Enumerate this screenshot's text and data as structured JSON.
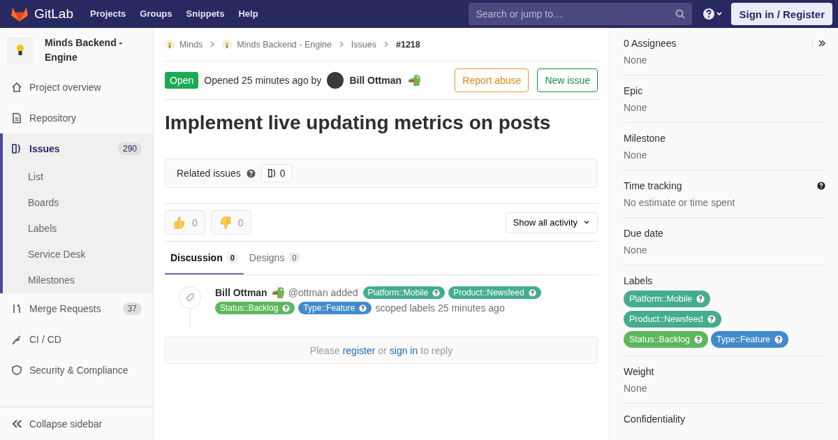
{
  "header": {
    "brand": "GitLab",
    "nav": [
      "Projects",
      "Groups",
      "Snippets",
      "Help"
    ],
    "search": {
      "placeholder": "Search or jump to…"
    },
    "sign_in": "Sign in / Register"
  },
  "sidebar": {
    "project": "Minds Backend - Engine",
    "items": [
      {
        "label": "Project overview",
        "selected": false
      },
      {
        "label": "Repository",
        "selected": false
      },
      {
        "label": "Issues",
        "count": "290",
        "selected": true,
        "children": [
          {
            "label": "List"
          },
          {
            "label": "Boards"
          },
          {
            "label": "Labels"
          },
          {
            "label": "Service Desk"
          },
          {
            "label": "Milestones"
          }
        ]
      },
      {
        "label": "Merge Requests",
        "count": "37",
        "selected": false
      },
      {
        "label": "CI / CD",
        "selected": false
      },
      {
        "label": "Security & Compliance",
        "selected": false
      }
    ],
    "collapse": "Collapse sidebar"
  },
  "breadcrumb": [
    "Minds",
    "Minds Backend - Engine",
    "Issues",
    "#1218"
  ],
  "issue": {
    "status": "Open",
    "opened": "Opened 25 minutes ago by",
    "author": "Bill Ottman",
    "report": "Report abuse",
    "new_issue": "New issue",
    "title": "Implement live updating metrics on posts"
  },
  "related": {
    "label": "Related issues",
    "count": "0"
  },
  "awards": [
    {
      "kind": "thumbsup",
      "count": "0"
    },
    {
      "kind": "thumbsdown",
      "count": "0"
    }
  ],
  "activity_filter": "Show all activity",
  "tabs": [
    {
      "label": "Discussion",
      "count": "0",
      "selected": true
    },
    {
      "label": "Designs",
      "count": "0",
      "selected": false
    }
  ],
  "note": {
    "author": "Bill Ottman",
    "handle": "@ottman added",
    "suffix": "scoped labels 25 minutes ago",
    "labels": [
      {
        "text": "Platform::Mobile",
        "color": "#44ad8e"
      },
      {
        "text": "Product::Newsfeed",
        "color": "#44ad8e"
      },
      {
        "text": "Status::Backlog",
        "color": "#5cb85c"
      },
      {
        "text": "Type::Feature",
        "color": "#428bca"
      }
    ]
  },
  "reply": {
    "before": "Please",
    "register": "register",
    "middle": "or",
    "sign_in": "sign in",
    "after": "to reply"
  },
  "right_sidebar": [
    {
      "kind": "text",
      "title": "0 Assignees",
      "value": "None"
    },
    {
      "kind": "text",
      "title": "Epic",
      "value": "None"
    },
    {
      "kind": "text",
      "title": "Milestone",
      "value": "None"
    },
    {
      "kind": "text",
      "title": "Time tracking",
      "value": "No estimate or time spent",
      "help": true
    },
    {
      "kind": "text",
      "title": "Due date",
      "value": "None"
    },
    {
      "kind": "labels",
      "title": "Labels",
      "labels": [
        {
          "text": "Platform::Mobile",
          "color": "#44ad8e"
        },
        {
          "text": "Product::Newsfeed",
          "color": "#44ad8e"
        },
        {
          "text": "Status::Backlog",
          "color": "#5cb85c"
        },
        {
          "text": "Type::Feature",
          "color": "#428bca"
        }
      ]
    },
    {
      "kind": "text",
      "title": "Weight",
      "value": "None"
    },
    {
      "kind": "title",
      "title": "Confidentiality"
    }
  ]
}
